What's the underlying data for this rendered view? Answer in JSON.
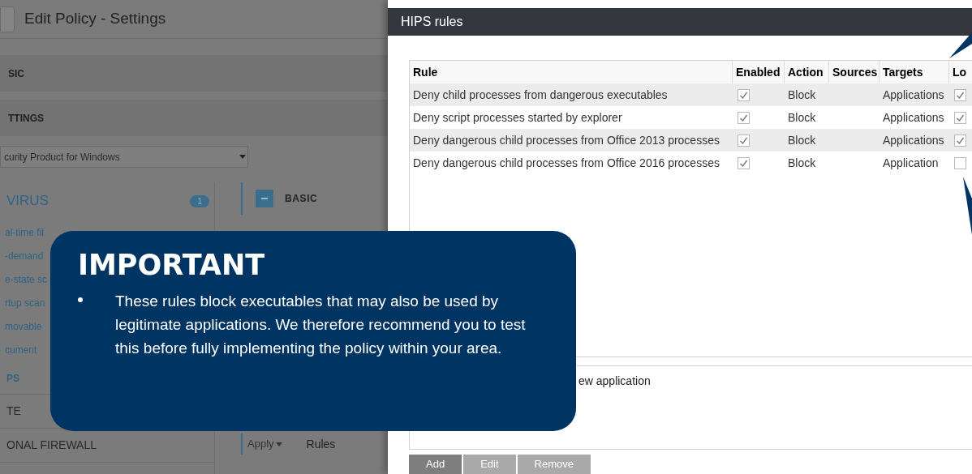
{
  "background_page": {
    "title": "Edit Policy - Settings",
    "sections": [
      "SIC",
      "TTINGS"
    ],
    "product_select": {
      "value": "curity Product for Windows"
    },
    "module_list": {
      "title": "VIRUS",
      "count": "1",
      "items": [
        "al-time fil",
        "-demand",
        "e-state sc",
        "rtup scan",
        "movable",
        "cument"
      ],
      "footer_items": [
        "PS",
        "TE",
        "ONAL FIREWALL"
      ]
    },
    "basic_section": {
      "title": "BASIC",
      "expanded": true,
      "apply_button": "Apply",
      "rules_label": "Rules"
    }
  },
  "dialog": {
    "title": "HIPS rules",
    "table": {
      "columns": [
        "Rule",
        "Enabled",
        "Action",
        "Sources",
        "Targets",
        "Lo"
      ],
      "rows": [
        {
          "rule": "Deny child processes from dangerous executables",
          "enabled": true,
          "action": "Block",
          "sources": "",
          "targets": "Applications",
          "column_6": true
        },
        {
          "rule": "Deny script processes started by explorer",
          "enabled": true,
          "action": "Block",
          "sources": "",
          "targets": "Applications",
          "column_6": true
        },
        {
          "rule": "Deny dangerous child processes from Office 2013 processes",
          "enabled": true,
          "action": "Block",
          "sources": "",
          "targets": "Applications",
          "column_6": true
        },
        {
          "rule": "Deny dangerous child processes from Office 2016 processes",
          "enabled": true,
          "action": "Block",
          "sources": "",
          "targets": "Application",
          "column_6": false
        }
      ]
    },
    "description": "ew application",
    "buttons": [
      {
        "label": "Add",
        "disabled": false
      },
      {
        "label": "Edit",
        "disabled": true
      },
      {
        "label": "Remove",
        "disabled": true
      }
    ]
  },
  "callout": {
    "title": "IMPORTANT",
    "bullets": [
      "These rules block executables that may also be used by legitimate applications. We therefore recommend you to test this before fully implementing the policy within your area."
    ]
  }
}
